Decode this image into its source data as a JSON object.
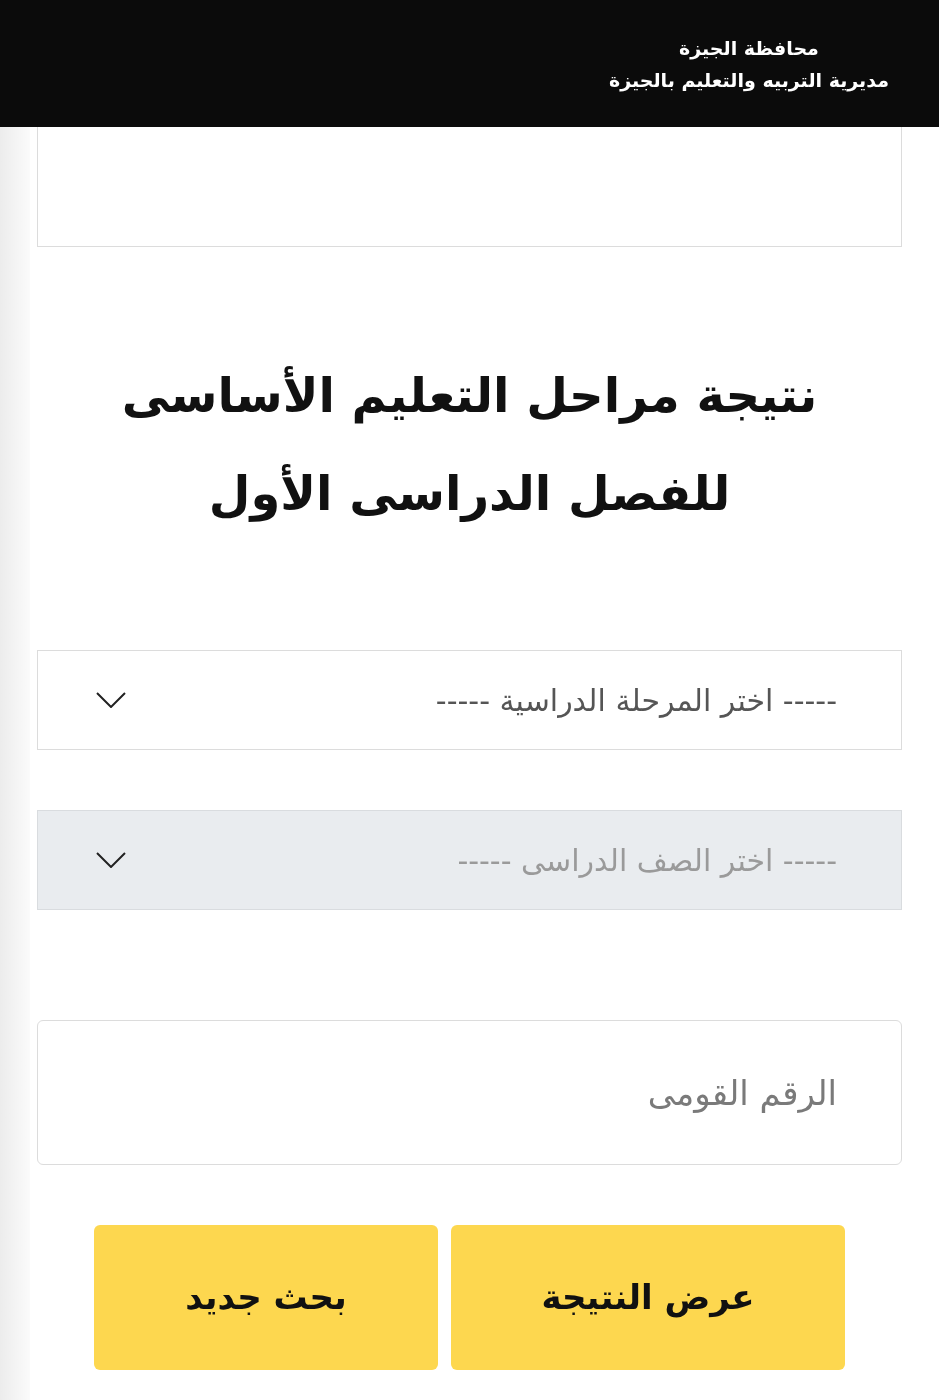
{
  "header": {
    "lines": [
      "محافظة الجيزة",
      "مديرية التربيه والتعليم بالجيزة"
    ]
  },
  "title": {
    "lines": [
      "نتيجة مراحل التعليم الأساسى",
      "للفصل الدراسى الأول"
    ]
  },
  "selects": [
    {
      "placeholder": "----- اختر المرحلة الدراسية -----",
      "disabled": false
    },
    {
      "placeholder": "----- اختر الصف الدراسى -----",
      "disabled": true
    }
  ],
  "national_id": {
    "placeholder": "الرقم القومى"
  },
  "buttons": [
    "عرض النتيجة",
    "بحث جديد"
  ]
}
